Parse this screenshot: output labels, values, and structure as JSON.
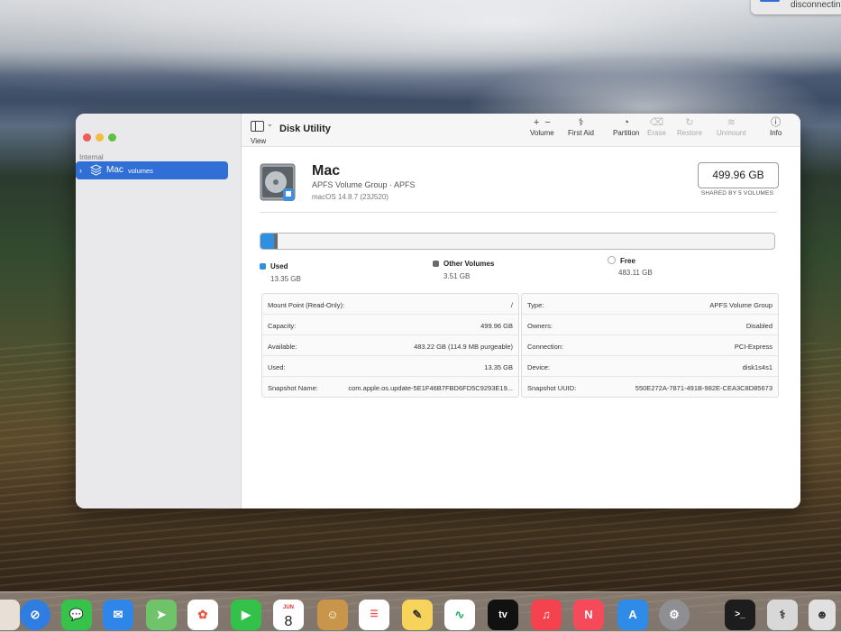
{
  "notification": {
    "text": "disconnectin"
  },
  "window": {
    "title": "Disk Utility",
    "view_label": "View",
    "sidebar": {
      "section": "Internal",
      "items": [
        {
          "label": "Mac",
          "detail": "volumes"
        }
      ]
    },
    "toolbar": {
      "buttons": [
        {
          "label": "Volume",
          "icon": "plus-minus-icon",
          "enabled": true
        },
        {
          "label": "First Aid",
          "icon": "stethoscope-icon",
          "enabled": true
        },
        {
          "label": "Partition",
          "icon": "pie-partition-icon",
          "enabled": true
        },
        {
          "label": "Erase",
          "icon": "erase-icon",
          "enabled": false
        },
        {
          "label": "Restore",
          "icon": "restore-icon",
          "enabled": false
        },
        {
          "label": "Unmount",
          "icon": "unmount-icon",
          "enabled": false
        },
        {
          "label": "Info",
          "icon": "info-icon",
          "enabled": true
        }
      ]
    },
    "volume": {
      "name": "Mac",
      "subtitle": "APFS Volume Group · APFS",
      "os": "macOS 14.8.7 (23J520)",
      "size": "499.96 GB",
      "shared": "SHARED BY 5 VOLUMES"
    },
    "usage": {
      "fractions": {
        "used": 0.027,
        "other": 0.007
      },
      "legend": [
        {
          "label": "Used",
          "value": "13.35 GB",
          "color": "#2f8fe0"
        },
        {
          "label": "Other Volumes",
          "value": "3.51 GB",
          "color": "#6b6b6b"
        },
        {
          "label": "Free",
          "value": "483.11 GB",
          "color": "#ffffff"
        }
      ]
    },
    "info_left": [
      {
        "k": "Mount Point (Read-Only):",
        "v": "/"
      },
      {
        "k": "Capacity:",
        "v": "499.96 GB"
      },
      {
        "k": "Available:",
        "v": "483.22 GB (114.9 MB purgeable)"
      },
      {
        "k": "Used:",
        "v": "13.35 GB"
      },
      {
        "k": "Snapshot Name:",
        "v": "com.apple.os.update-5E1F46B7FBD6FD5C9293E19..."
      }
    ],
    "info_right": [
      {
        "k": "Type:",
        "v": "APFS Volume Group"
      },
      {
        "k": "Owners:",
        "v": "Disabled"
      },
      {
        "k": "Connection:",
        "v": "PCI-Express"
      },
      {
        "k": "Device:",
        "v": "disk1s4s1"
      },
      {
        "k": "Snapshot UUID:",
        "v": "550E272A-7871-491B-982E-CEA3C8D85673"
      }
    ]
  },
  "dock": {
    "calendar_month": "JUN",
    "calendar_day": "8",
    "apps": [
      "safari-icon",
      "messages-icon",
      "mail-icon",
      "maps-icon",
      "photos-icon",
      "facetime-icon",
      "calendar-icon",
      "contacts-icon",
      "reminders-icon",
      "notes-icon",
      "freeform-icon",
      "apple-tv-icon",
      "music-icon",
      "news-icon",
      "app-store-icon",
      "system-settings-icon",
      "terminal-icon",
      "disk-utility-icon",
      "finder-icon"
    ],
    "tv_label": "tv"
  }
}
